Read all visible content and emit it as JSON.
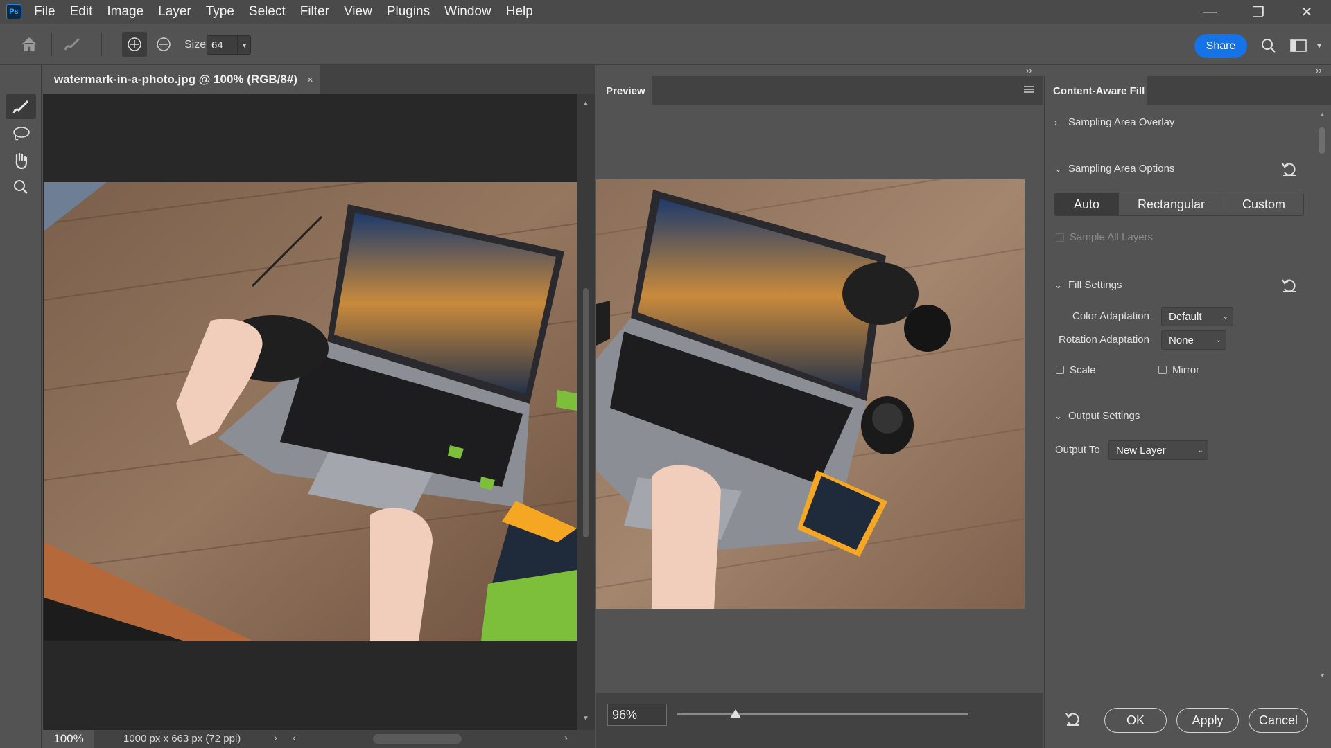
{
  "app": {
    "logo": "Ps"
  },
  "menu": [
    "File",
    "Edit",
    "Image",
    "Layer",
    "Type",
    "Select",
    "Filter",
    "View",
    "Plugins",
    "Window",
    "Help"
  ],
  "window_controls": {
    "minimize": "—",
    "restore": "❐",
    "close": "✕"
  },
  "options": {
    "size_label": "Size",
    "size_value": "64",
    "share_label": "Share"
  },
  "document": {
    "tab_title": "watermark-in-a-photo.jpg @ 100% (RGB/8#)",
    "close_symbol": "×",
    "zoom": "100%",
    "info": "1000 px x 663 px (72 ppi)"
  },
  "preview": {
    "tab_label": "Preview",
    "zoom_value": "96%",
    "zoom_slider_fraction": 0.2
  },
  "panel": {
    "tab_label": "Content-Aware Fill",
    "sampling_overlay": "Sampling Area Overlay",
    "sampling_options": "Sampling Area Options",
    "modes": [
      "Auto",
      "Rectangular",
      "Custom"
    ],
    "selected_mode": "Auto",
    "sample_all_layers": "Sample All Layers",
    "fill_settings": "Fill Settings",
    "color_adaptation_label": "Color Adaptation",
    "color_adaptation_value": "Default",
    "rotation_adaptation_label": "Rotation Adaptation",
    "rotation_adaptation_value": "None",
    "scale_label": "Scale",
    "mirror_label": "Mirror",
    "output_settings": "Output Settings",
    "output_to_label": "Output To",
    "output_to_value": "New Layer"
  },
  "buttons": {
    "ok": "OK",
    "apply": "Apply",
    "cancel": "Cancel"
  },
  "colors": {
    "accent": "#1473e6",
    "overlay_green": "#7dbf3a",
    "drive_orange": "#f5a623"
  }
}
